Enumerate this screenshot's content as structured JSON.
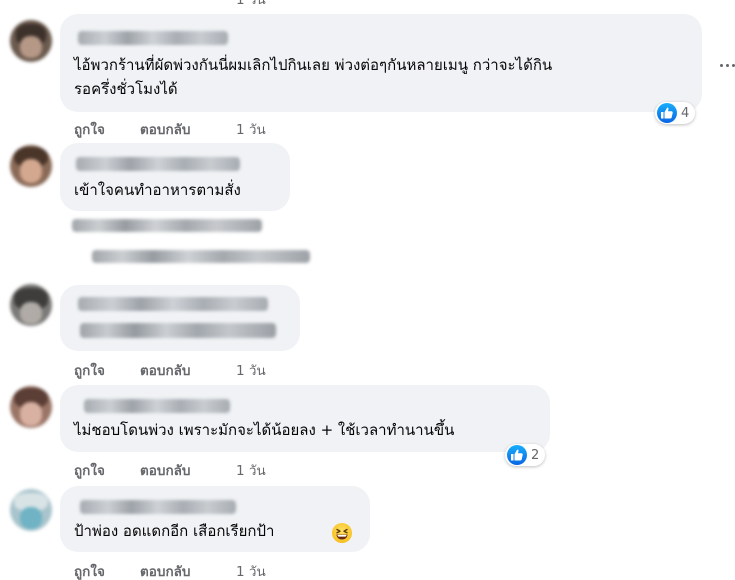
{
  "top_cut": {
    "actions": [
      "ถูกใจ",
      "ตอบกลับ",
      "1 วัน"
    ]
  },
  "comments": [
    {
      "text_lines": [
        "ไอ้พวกร้านที่ผัดพ่วงกันนี่ผมเลิกไปกินเลย พ่วงต่อๆกันหลายเมนู กว่าจะได้กิน",
        "รอครึ่งชั่วโมงได้"
      ],
      "reaction": {
        "icon": "like-icon",
        "count": "4"
      },
      "actions": {
        "like": "ถูกใจ",
        "reply": "ตอบกลับ",
        "time": "1 วัน"
      }
    },
    {
      "text_lines": [
        "เข้าใจคนทำอาหารตามสั่ง"
      ]
    },
    {
      "text_lines": [],
      "actions": {
        "like": "ถูกใจ",
        "reply": "ตอบกลับ",
        "time": "1 วัน"
      }
    },
    {
      "text_lines": [
        "ไม่ชอบโดนพ่วง เพราะมักจะได้น้อยลง + ใช้เวลาทำนานขึ้น"
      ],
      "reaction": {
        "icon": "like-icon",
        "count": "2"
      },
      "actions": {
        "like": "ถูกใจ",
        "reply": "ตอบกลับ",
        "time": "1 วัน"
      }
    },
    {
      "text_lines": [
        "ป้าพ่อง อดแดกอีก เสือกเรียกป้า"
      ],
      "emoji": "grinning-squinting-face-icon",
      "actions": {
        "like": "ถูกใจ",
        "reply": "ตอบกลับ",
        "time": "1 วัน"
      }
    }
  ],
  "colors": {
    "bubble": "#f0f2f5",
    "action_text": "#65676b",
    "like_blue": "#0a66e4"
  },
  "icons": {
    "more": "more-options-icon"
  }
}
